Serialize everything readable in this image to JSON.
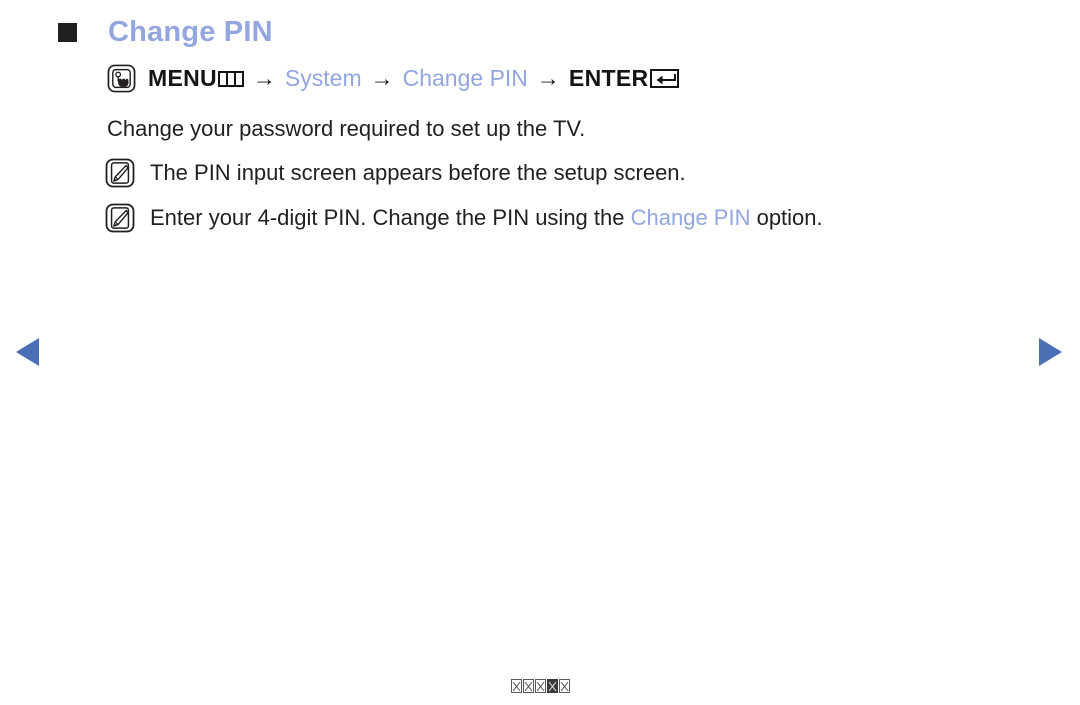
{
  "heading": {
    "bullet": "black-square-bullet",
    "title": "Change PIN"
  },
  "menu_path": {
    "press_icon": "press-button-hand-icon",
    "menu_label": "MENU",
    "menu_glyph": "menu-button-glyph",
    "arrow1": "→",
    "step_system": "System",
    "arrow2": "→",
    "step_change_pin": "Change PIN",
    "arrow3": "→",
    "enter_label": "ENTER",
    "enter_glyph": "enter-return-key-glyph"
  },
  "body": {
    "paragraph1": "Change your password required to set up the TV."
  },
  "notes": [
    {
      "icon": "note-pencil-icon",
      "text_before": "The PIN input screen appears before the setup screen.",
      "highlight": "",
      "text_after": ""
    },
    {
      "icon": "note-pencil-icon",
      "text_before": "Enter your 4-digit PIN. Change the PIN using the ",
      "highlight": "Change PIN",
      "text_after": " option."
    }
  ],
  "navigation": {
    "prev_label": "previous-page-arrow",
    "next_label": "next-page-arrow"
  },
  "footer": {
    "glyph_count": 5,
    "note": "unrendered-glyphs"
  },
  "colors": {
    "accent_blue": "#93a6df",
    "nav_blue": "#4b6fb5",
    "text_black": "#231f20",
    "background": "#ffffff"
  }
}
